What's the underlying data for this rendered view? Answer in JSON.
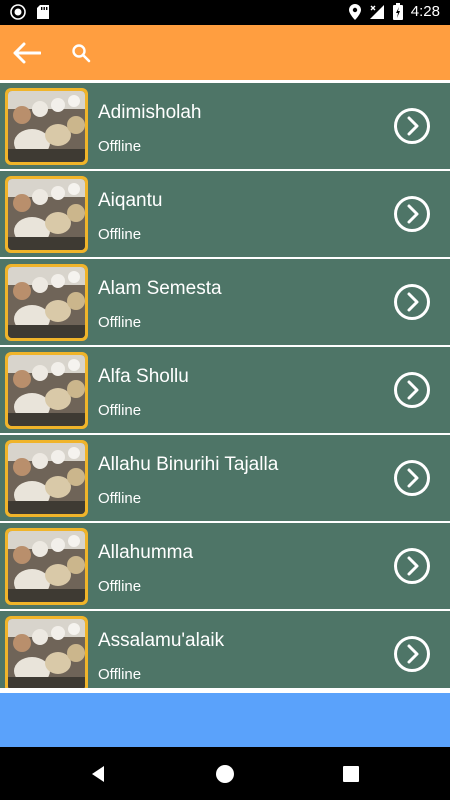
{
  "status_bar": {
    "time": "4:28",
    "icons": [
      "camera-icon",
      "sd-card-icon",
      "location-icon",
      "signal-icon",
      "battery-icon"
    ]
  },
  "app_bar": {
    "background": "#ff9e40",
    "back_icon": "arrow-back-icon",
    "search_icon": "search-icon"
  },
  "list": {
    "item_background": "#4e7567",
    "items": [
      {
        "title": "Adimisholah",
        "subtitle": "Offline"
      },
      {
        "title": "Aiqantu",
        "subtitle": "Offline"
      },
      {
        "title": "Alam Semesta",
        "subtitle": "Offline"
      },
      {
        "title": "Alfa Shollu",
        "subtitle": "Offline"
      },
      {
        "title": "Allahu Binurihi Tajalla",
        "subtitle": "Offline"
      },
      {
        "title": "Allahumma",
        "subtitle": "Offline"
      },
      {
        "title": "Assalamu'alaik",
        "subtitle": "Offline"
      }
    ]
  },
  "banner": {
    "background": "#5aa2fb"
  },
  "nav_bar": {
    "icons": [
      "back-triangle-icon",
      "home-circle-icon",
      "recents-square-icon"
    ]
  }
}
